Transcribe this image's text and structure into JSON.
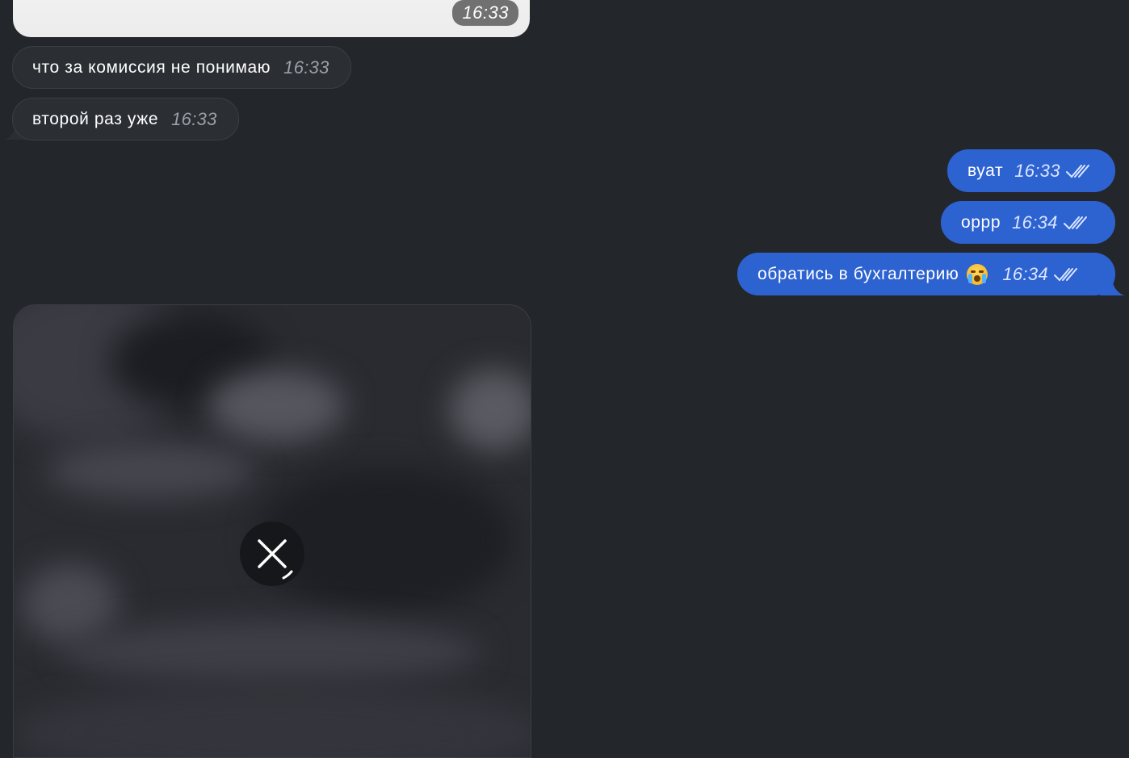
{
  "chat": {
    "top_image_time": "16:33",
    "incoming": [
      {
        "text": "что за комиссия не понимаю",
        "time": "16:33"
      },
      {
        "text": "второй раз уже",
        "time": "16:33"
      }
    ],
    "outgoing": [
      {
        "text": "вуат",
        "time": "16:33",
        "status": "read"
      },
      {
        "text": "оррр",
        "time": "16:34",
        "status": "read"
      },
      {
        "text": "обратись в бухгалтерию",
        "time": "16:34",
        "status": "read",
        "emoji": "loudly-crying-face"
      }
    ],
    "media": {
      "state": "loading",
      "action": "cancel-download"
    }
  },
  "colors": {
    "background": "#23272b",
    "incoming_bubble": "#2b2e33",
    "outgoing_bubble": "#2d62d1"
  }
}
